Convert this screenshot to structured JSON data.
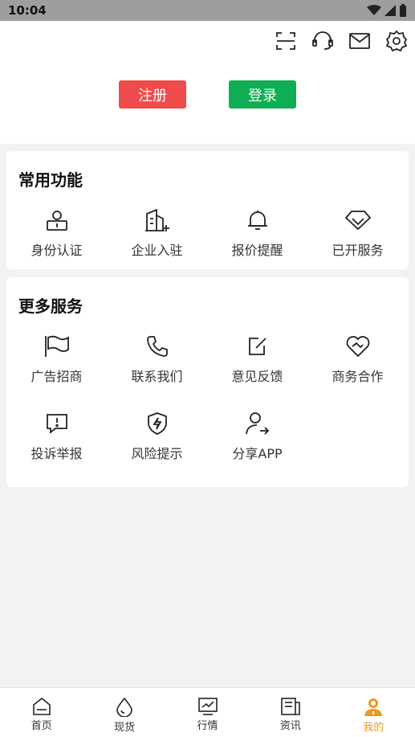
{
  "status": {
    "time": "10:04"
  },
  "header": {
    "icons": [
      "scan-icon",
      "headset-icon",
      "mail-icon",
      "settings-icon"
    ],
    "register_label": "注册",
    "login_label": "登录",
    "register_color": "#f04b4b",
    "login_color": "#0fae52"
  },
  "common": {
    "title": "常用功能",
    "items": [
      {
        "label": "身份认证",
        "icon": "id-card-icon"
      },
      {
        "label": "企业入驻",
        "icon": "building-icon"
      },
      {
        "label": "报价提醒",
        "icon": "bell-icon"
      },
      {
        "label": "已开服务",
        "icon": "diamond-icon"
      }
    ]
  },
  "more": {
    "title": "更多服务",
    "items": [
      {
        "label": "广告招商",
        "icon": "flag-icon"
      },
      {
        "label": "联系我们",
        "icon": "phone-icon"
      },
      {
        "label": "意见反馈",
        "icon": "edit-icon"
      },
      {
        "label": "商务合作",
        "icon": "handshake-heart-icon"
      },
      {
        "label": "投诉举报",
        "icon": "report-icon"
      },
      {
        "label": "风险提示",
        "icon": "shield-bolt-icon"
      },
      {
        "label": "分享APP",
        "icon": "user-share-icon"
      }
    ]
  },
  "tabs": [
    {
      "label": "首页",
      "icon": "home-icon"
    },
    {
      "label": "现货",
      "icon": "drop-icon"
    },
    {
      "label": "行情",
      "icon": "chart-icon"
    },
    {
      "label": "资讯",
      "icon": "news-icon"
    },
    {
      "label": "我的",
      "icon": "profile-icon",
      "active": true
    }
  ],
  "colors": {
    "accent": "#ee9a1c"
  }
}
